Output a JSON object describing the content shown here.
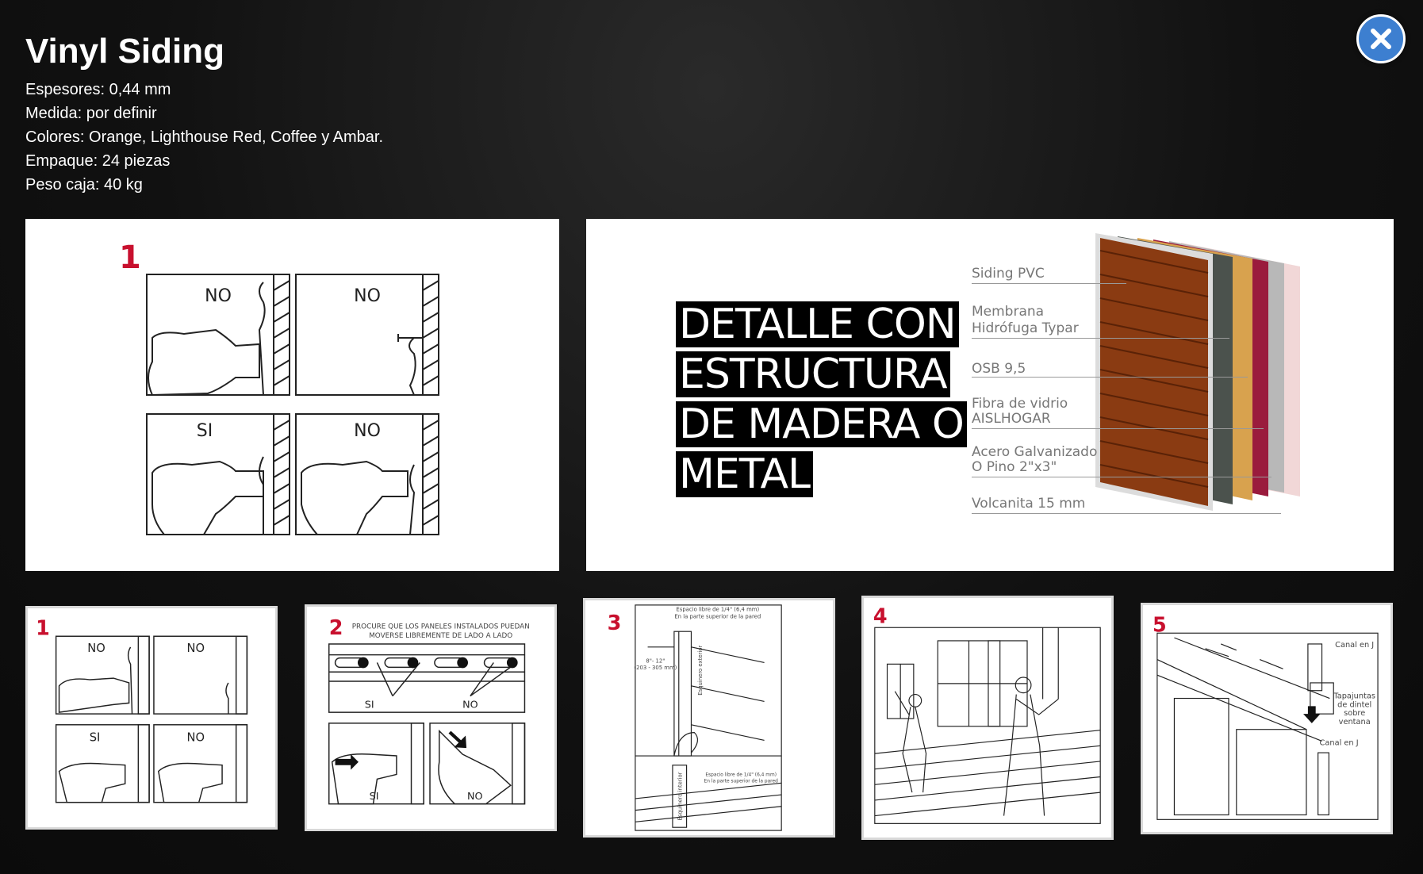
{
  "product": {
    "title": "Vinyl Siding",
    "specs": [
      "Espesores: 0,44 mm",
      "Medida: por definir",
      "Colores: Orange, Lighthouse Red, Coffee y Ambar.",
      "Empaque: 24 piezas",
      "Peso caja: 40 kg"
    ]
  },
  "close_icon": "close-icon",
  "main_image": {
    "step_number": "1",
    "cells": [
      "NO",
      "NO",
      "SI",
      "NO"
    ]
  },
  "detail": {
    "lines": [
      "DETALLE CON",
      "ESTRUCTURA",
      "DE MADERA O",
      "METAL"
    ],
    "layers": [
      "Siding PVC",
      "Membrana",
      "Hidrófuga Typar",
      "OSB 9,5",
      "Fibra de vidrio",
      "AISLHOGAR",
      "Acero Galvanizado",
      "O Pino 2\"x3\"",
      "Volcanita 15 mm"
    ]
  },
  "thumbnails": [
    {
      "number": "1",
      "labels": [
        "NO",
        "NO",
        "SI",
        "NO"
      ]
    },
    {
      "number": "2",
      "caption_1": "PROCURE QUE LOS PANELES INSTALADOS PUEDAN",
      "caption_2": "MOVERSE LIBREMENTE DE LADO A LADO",
      "labels": [
        "SI",
        "NO",
        "SI",
        "NO"
      ]
    },
    {
      "number": "3",
      "note_1": "Espacio libre de 1/4\" (6,4 mm)",
      "note_2": "En la parte superior de la pared",
      "note_3": "8\"- 12\"",
      "note_4": "(203 - 305 mm)",
      "note_5": "Esquinero exterior",
      "note_6": "Esquinero interior",
      "note_7": "Espacio libre de 1/4\" (6,4 mm)",
      "note_8": "En la parte superior de la pared"
    },
    {
      "number": "4"
    },
    {
      "number": "5",
      "note_1": "Canal en J",
      "note_2": "Tapajuntas",
      "note_3": "de dintel",
      "note_4": "sobre",
      "note_5": "ventana",
      "note_6": "Canal en J"
    }
  ],
  "colors": {
    "accent": "#c8102e",
    "close": "#3d7fd0",
    "background": "#0f0f0f"
  }
}
